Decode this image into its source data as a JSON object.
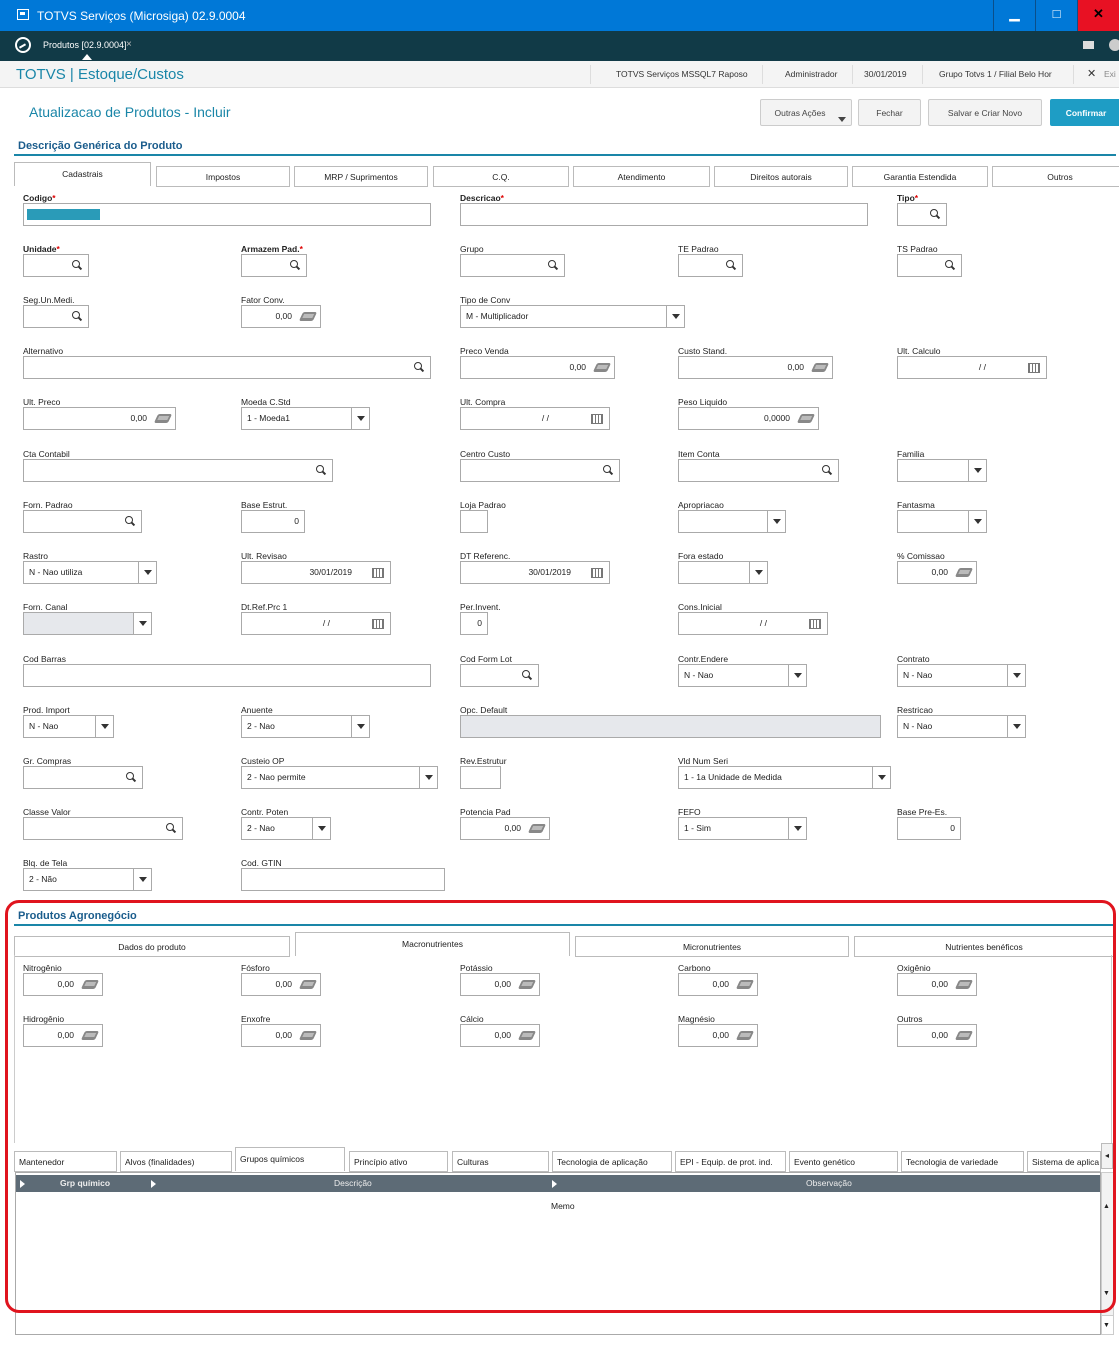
{
  "window": {
    "title": "TOTVS Serviços (Microsiga) 02.9.0004",
    "min": "▁",
    "max": "□",
    "close": "✕"
  },
  "tabbar": {
    "doc_tab": "Produtos [02.9.0004]",
    "doc_tab_close": "×"
  },
  "app": {
    "title": "TOTVS | Estoque/Custos",
    "server": "TOTVS Serviços MSSQL7 Raposo",
    "user": "Administrador",
    "date": "30/01/2019",
    "company": "Grupo Totvs 1 / Filial Belo Hor",
    "exit": "Exi",
    "exit_x": "✕"
  },
  "page": {
    "title": "Atualizacao de Produtos - Incluir"
  },
  "actions": {
    "outras": "Outras Ações",
    "fechar": "Fechar",
    "salvar_novo": "Salvar e Criar Novo",
    "confirmar": "Confirmar"
  },
  "section1": {
    "title": "Descrição Genérica do Produto"
  },
  "tabs1": [
    "Cadastrais",
    "Impostos",
    "MRP / Suprimentos",
    "C.Q.",
    "Atendimento",
    "Direitos autorais",
    "Garantia Estendida",
    "Outros"
  ],
  "fields": {
    "codigo": {
      "label": "Codigo"
    },
    "descricao": {
      "label": "Descricao"
    },
    "tipo": {
      "label": "Tipo"
    },
    "unidade": {
      "label": "Unidade"
    },
    "armazem": {
      "label": "Armazem Pad."
    },
    "grupo": {
      "label": "Grupo"
    },
    "te": {
      "label": "TE Padrao"
    },
    "ts": {
      "label": "TS Padrao"
    },
    "segun": {
      "label": "Seg.Un.Medi."
    },
    "fator": {
      "label": "Fator Conv.",
      "value": "0,00"
    },
    "tipoconv": {
      "label": "Tipo de Conv",
      "value": "M - Multiplicador"
    },
    "alternativo": {
      "label": "Alternativo"
    },
    "precovenda": {
      "label": "Preco Venda",
      "value": "0,00"
    },
    "custostand": {
      "label": "Custo Stand.",
      "value": "0,00"
    },
    "ultcalc": {
      "label": "Ult. Calculo",
      "value": "/ /"
    },
    "ultpreco": {
      "label": "Ult. Preco",
      "value": "0,00"
    },
    "moeda": {
      "label": "Moeda C.Std",
      "value": "1 - Moeda1"
    },
    "ultcompra": {
      "label": "Ult. Compra",
      "value": "/ /"
    },
    "peso": {
      "label": "Peso Liquido",
      "value": "0,0000"
    },
    "ctacontabil": {
      "label": "Cta Contabil"
    },
    "centrocusto": {
      "label": "Centro Custo"
    },
    "itemconta": {
      "label": "Item Conta"
    },
    "familia": {
      "label": "Familia"
    },
    "fornpadrao": {
      "label": "Forn. Padrao"
    },
    "baseestrut": {
      "label": "Base Estrut.",
      "value": "0"
    },
    "lojapadrao": {
      "label": "Loja Padrao"
    },
    "apropriacao": {
      "label": "Apropriacao"
    },
    "fantasma": {
      "label": "Fantasma"
    },
    "rastro": {
      "label": "Rastro",
      "value": "N - Nao utiliza"
    },
    "ultrevisao": {
      "label": "Ult. Revisao",
      "value": "30/01/2019"
    },
    "dtreferenc": {
      "label": "DT Referenc.",
      "value": "30/01/2019"
    },
    "foraestado": {
      "label": "Fora estado"
    },
    "comissao": {
      "label": "% Comissao",
      "value": "0,00"
    },
    "forncanal": {
      "label": "Forn. Canal"
    },
    "dtrefprc": {
      "label": "Dt.Ref.Prc 1",
      "value": "/ /"
    },
    "perinvent": {
      "label": "Per.Invent.",
      "value": "0"
    },
    "consinicial": {
      "label": "Cons.Inicial",
      "value": "/ /"
    },
    "codbarras": {
      "label": "Cod Barras"
    },
    "codformlot": {
      "label": "Cod Form Lot"
    },
    "contrendere": {
      "label": "Contr.Endere",
      "value": "N - Nao"
    },
    "contrato": {
      "label": "Contrato",
      "value": "N - Nao"
    },
    "prodimport": {
      "label": "Prod. Import",
      "value": "N - Nao"
    },
    "anuente": {
      "label": "Anuente",
      "value": "2 - Nao"
    },
    "opcdefault": {
      "label": "Opc. Default"
    },
    "restricao": {
      "label": "Restricao",
      "value": "N - Nao"
    },
    "grcompras": {
      "label": "Gr. Compras"
    },
    "custeioop": {
      "label": "Custeio OP",
      "value": "2 - Nao permite"
    },
    "revestrutur": {
      "label": "Rev.Estrutur"
    },
    "vldnumseri": {
      "label": "Vld Num Seri",
      "value": "1 - 1a Unidade de Medida"
    },
    "classevalor": {
      "label": "Classe Valor"
    },
    "contrpoten": {
      "label": "Contr. Poten",
      "value": "2 - Nao"
    },
    "potenciapad": {
      "label": "Potencia Pad",
      "value": "0,00"
    },
    "fefo": {
      "label": "FEFO",
      "value": "1 - Sim"
    },
    "baseprees": {
      "label": "Base Pre-Es.",
      "value": "0"
    },
    "blqtela": {
      "label": "Blq. de Tela",
      "value": "2 - Não"
    },
    "codgtin": {
      "label": "Cod. GTIN"
    }
  },
  "section2": {
    "title": "Produtos Agronegócio"
  },
  "tabs2": [
    "Dados do produto",
    "Macronutrientes",
    "Micronutrientes",
    "Nutrientes benéficos"
  ],
  "nutrients": [
    {
      "label": "Nitrogênio",
      "value": "0,00"
    },
    {
      "label": "Fósforo",
      "value": "0,00"
    },
    {
      "label": "Potássio",
      "value": "0,00"
    },
    {
      "label": "Carbono",
      "value": "0,00"
    },
    {
      "label": "Oxigênio",
      "value": "0,00"
    },
    {
      "label": "Hidrogênio",
      "value": "0,00"
    },
    {
      "label": "Enxofre",
      "value": "0,00"
    },
    {
      "label": "Cálcio",
      "value": "0,00"
    },
    {
      "label": "Magnésio",
      "value": "0,00"
    },
    {
      "label": "Outros",
      "value": "0,00"
    }
  ],
  "tabs3": [
    "Mantenedor",
    "Alvos (finalidades)",
    "Grupos químicos",
    "Princípio ativo",
    "Culturas",
    "Tecnologia de aplicação",
    "EPI - Equip. de prot. ind.",
    "Evento genético",
    "Tecnologia de variedade",
    "Sistema de aplica"
  ],
  "grid": {
    "columns": [
      "Grp químico",
      "Descrição",
      "Observação"
    ],
    "row_memo": "Memo"
  },
  "colors": {
    "accent": "#1a86a8",
    "titlebar": "#0078d7",
    "highlight": "#e0141e"
  }
}
